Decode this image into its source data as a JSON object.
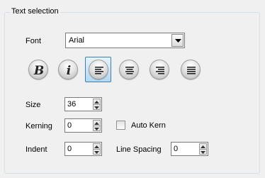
{
  "group": {
    "title": "Text selection"
  },
  "font": {
    "label": "Font",
    "value": "Arial"
  },
  "style_buttons": [
    {
      "name": "bold-button",
      "icon": "bold-icon",
      "letter": "B",
      "selected": false
    },
    {
      "name": "italic-button",
      "icon": "italic-icon",
      "letter": "i",
      "selected": false
    },
    {
      "name": "align-left-button",
      "icon": "align-left-icon",
      "letter": "",
      "selected": true
    },
    {
      "name": "align-center-button",
      "icon": "align-center-icon",
      "letter": "",
      "selected": false
    },
    {
      "name": "align-right-button",
      "icon": "align-right-icon",
      "letter": "",
      "selected": false
    },
    {
      "name": "justify-button",
      "icon": "justify-icon",
      "letter": "",
      "selected": false
    }
  ],
  "size": {
    "label": "Size",
    "value": "36"
  },
  "kerning": {
    "label": "Kerning",
    "value": "0"
  },
  "auto_kern": {
    "label": "Auto Kern",
    "checked": false
  },
  "indent": {
    "label": "Indent",
    "value": "0"
  },
  "line_spacing": {
    "label": "Line Spacing",
    "value": "0"
  },
  "colors": {
    "selection_border": "#3c7fb1",
    "selection_fill": "#c9e4f6",
    "groupbox_border": "#d5dfe5"
  }
}
